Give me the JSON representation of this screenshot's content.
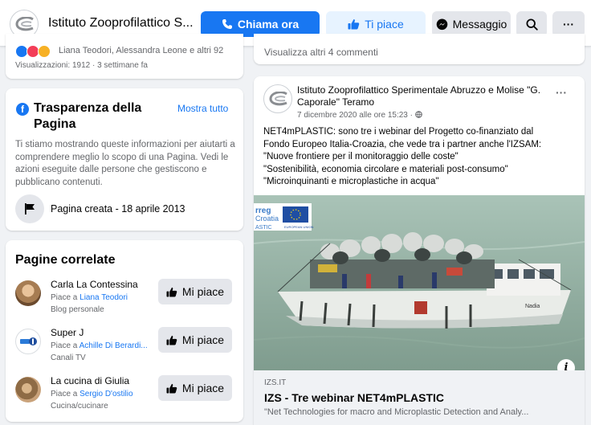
{
  "header": {
    "page_name": "Istituto Zooprofilattico S...",
    "call_label": "Chiama ora",
    "like_label": "Ti piace",
    "message_label": "Messaggio",
    "more_label": "···"
  },
  "reactions": {
    "names": "Liana Teodori, Alessandra Leone e altri 92",
    "views": "Visualizzazioni: 1912 · 3 settimane fa"
  },
  "comments": {
    "more_label": "Visualizza altri 4 commenti"
  },
  "transparency": {
    "title": "Trasparenza della Pagina",
    "link": "Mostra tutto",
    "text": "Ti stiamo mostrando queste informazioni per aiutarti a comprendere meglio lo scopo di una Pagina. Vedi le azioni eseguite dalle persone che gestiscono e pubblicano contenuti.",
    "created": "Pagina creata - 18 aprile 2013"
  },
  "related": {
    "title": "Pagine correlate",
    "button_label": "Mi piace",
    "items": [
      {
        "name": "Carla La Contessina",
        "liked_prefix": "Piace a ",
        "liked_by": "Liana Teodori",
        "category": "Blog personale"
      },
      {
        "name": "Super J",
        "liked_prefix": "Piace a ",
        "liked_by": "Achille Di Berardi...",
        "category": "Canali TV"
      },
      {
        "name": "La cucina di Giulia",
        "liked_prefix": "Piace a ",
        "liked_by": "Sergio D'ostilio",
        "category": "Cucina/cucinare"
      }
    ]
  },
  "post": {
    "author": "Istituto Zooprofilattico Sperimentale Abruzzo e Molise \"G. Caporale\" Teramo",
    "date": "7 dicembre 2020 alle ore 15:23 · ",
    "text_lines": [
      "NET4mPLASTIC: sono tre i webinar del Progetto co-finanziato dal",
      "Fondo Europeo Italia-Croazia, che vede tra i partner anche l'IZSAM:",
      "\"Nuove frontiere per il monitoraggio delle coste\"",
      "\"Sostenibilità, economia circolare e materiali post-consumo\"",
      "\"Microinquinanti e microplastiche in acqua\""
    ],
    "image_badge_line1": "rreg",
    "image_badge_line2": "Croatia",
    "image_badge_line3": "ASTIC",
    "image_eu_caption": "EUROPEAN UNION",
    "boat_name": "Nadia",
    "link_domain": "IZS.IT",
    "link_title": "IZS - Tre webinar NET4mPLASTIC",
    "link_desc": "\"Net Technologies for macro and Microplastic Detection and Analy..."
  }
}
